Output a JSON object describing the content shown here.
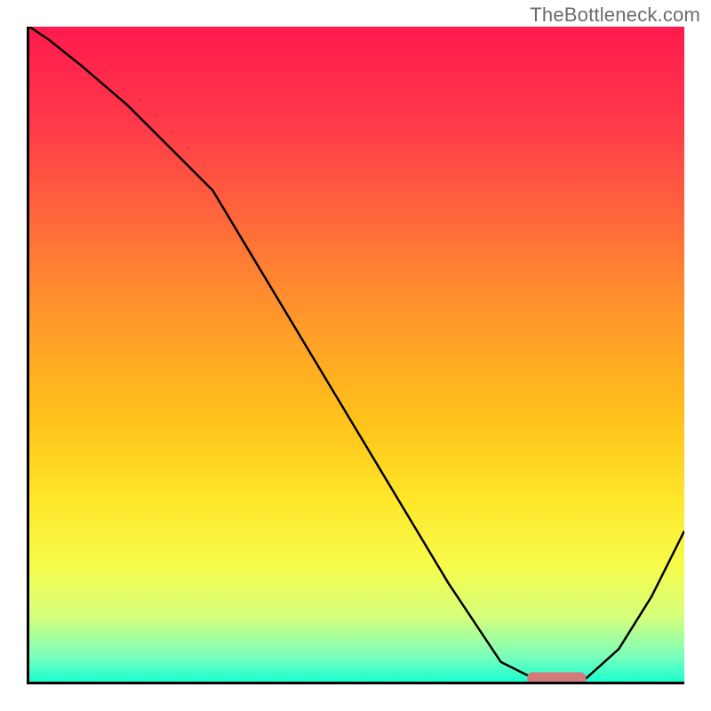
{
  "watermark": "TheBottleneck.com",
  "chart_data": {
    "type": "line",
    "title": "",
    "xlabel": "",
    "ylabel": "",
    "xlim": [
      0,
      100
    ],
    "ylim": [
      0,
      100
    ],
    "grid": false,
    "series": [
      {
        "name": "curve",
        "x": [
          0,
          3,
          8,
          15,
          22,
          28,
          34,
          40,
          46,
          52,
          58,
          64,
          70,
          72,
          76,
          80,
          83,
          85,
          90,
          95,
          100
        ],
        "values": [
          100,
          98,
          94,
          88,
          81,
          75,
          65,
          55,
          45,
          35,
          25,
          15,
          6,
          3,
          1,
          0.5,
          0.5,
          0.5,
          5,
          13,
          23
        ]
      }
    ],
    "marker": {
      "x_range": [
        76,
        85
      ],
      "y": 0.5,
      "color": "#d37a7a"
    },
    "gradient_stops": [
      {
        "offset": 0.0,
        "color": "#ff1a4d"
      },
      {
        "offset": 0.15,
        "color": "#ff3a4a"
      },
      {
        "offset": 0.3,
        "color": "#ff6a3a"
      },
      {
        "offset": 0.45,
        "color": "#ff9a2a"
      },
      {
        "offset": 0.6,
        "color": "#ffc21a"
      },
      {
        "offset": 0.72,
        "color": "#ffe62a"
      },
      {
        "offset": 0.82,
        "color": "#f7fb4a"
      },
      {
        "offset": 0.9,
        "color": "#d6ff7a"
      },
      {
        "offset": 0.96,
        "color": "#7dffba"
      },
      {
        "offset": 1.0,
        "color": "#1affd1"
      }
    ]
  }
}
